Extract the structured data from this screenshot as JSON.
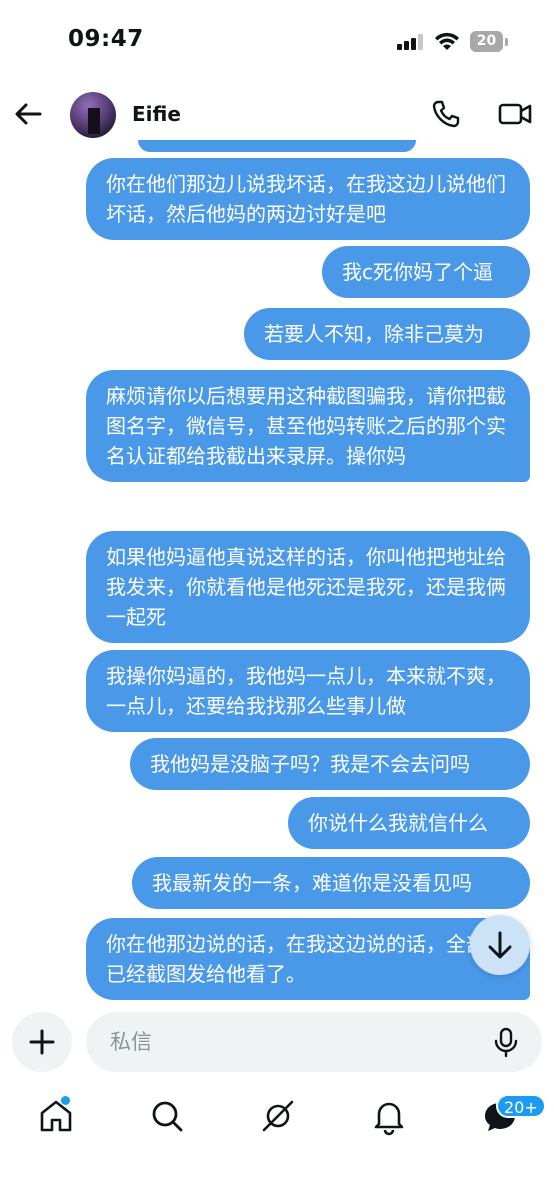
{
  "status_bar": {
    "time": "09:47",
    "battery": "20"
  },
  "header": {
    "contact_name": "Eifie"
  },
  "messages": [
    {
      "text": "你在他们那边儿说我坏话，在我这边儿说他们坏话，然后他妈的两边讨好是吧"
    },
    {
      "text": "我c死你妈了个逼"
    },
    {
      "text": "若要人不知，除非己莫为"
    },
    {
      "text": "麻烦请你以后想要用这种截图骗我，请你把截图名字，微信号，甚至他妈转账之后的那个实名认证都给我截出来录屏。操你妈"
    },
    {
      "text": "如果他妈逼他真说这样的话，你叫他把地址给我发来，你就看他是他死还是我死，还是我俩一起死"
    },
    {
      "text": "我操你妈逼的，我他妈一点儿，本来就不爽，一点儿，还要给我找那么些事儿做"
    },
    {
      "text": "我他妈是没脑子吗？我是不会去问吗"
    },
    {
      "text": "你说什么我就信什么"
    },
    {
      "text": "我最新发的一条，难道你是没看见吗"
    },
    {
      "text": "你在他那边说的话，在我这边说的话，全部都已经截图发给他看了。"
    }
  ],
  "composer": {
    "placeholder": "私信"
  },
  "bottom_nav": {
    "messages_badge": "20+"
  },
  "colors": {
    "bubble": "#4a99e9",
    "accent": "#1d9bf0",
    "input_bg": "#eff3f4"
  }
}
